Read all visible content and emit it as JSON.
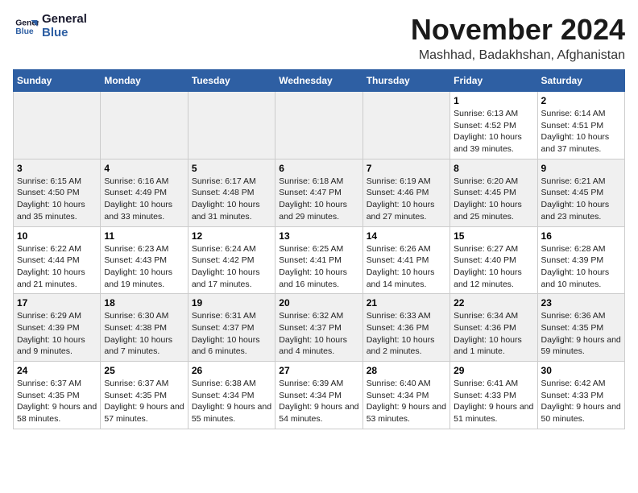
{
  "logo": {
    "line1": "General",
    "line2": "Blue"
  },
  "title": "November 2024",
  "location": "Mashhad, Badakhshan, Afghanistan",
  "weekdays": [
    "Sunday",
    "Monday",
    "Tuesday",
    "Wednesday",
    "Thursday",
    "Friday",
    "Saturday"
  ],
  "weeks": [
    [
      {
        "day": "",
        "info": ""
      },
      {
        "day": "",
        "info": ""
      },
      {
        "day": "",
        "info": ""
      },
      {
        "day": "",
        "info": ""
      },
      {
        "day": "",
        "info": ""
      },
      {
        "day": "1",
        "info": "Sunrise: 6:13 AM\nSunset: 4:52 PM\nDaylight: 10 hours and 39 minutes."
      },
      {
        "day": "2",
        "info": "Sunrise: 6:14 AM\nSunset: 4:51 PM\nDaylight: 10 hours and 37 minutes."
      }
    ],
    [
      {
        "day": "3",
        "info": "Sunrise: 6:15 AM\nSunset: 4:50 PM\nDaylight: 10 hours and 35 minutes."
      },
      {
        "day": "4",
        "info": "Sunrise: 6:16 AM\nSunset: 4:49 PM\nDaylight: 10 hours and 33 minutes."
      },
      {
        "day": "5",
        "info": "Sunrise: 6:17 AM\nSunset: 4:48 PM\nDaylight: 10 hours and 31 minutes."
      },
      {
        "day": "6",
        "info": "Sunrise: 6:18 AM\nSunset: 4:47 PM\nDaylight: 10 hours and 29 minutes."
      },
      {
        "day": "7",
        "info": "Sunrise: 6:19 AM\nSunset: 4:46 PM\nDaylight: 10 hours and 27 minutes."
      },
      {
        "day": "8",
        "info": "Sunrise: 6:20 AM\nSunset: 4:45 PM\nDaylight: 10 hours and 25 minutes."
      },
      {
        "day": "9",
        "info": "Sunrise: 6:21 AM\nSunset: 4:45 PM\nDaylight: 10 hours and 23 minutes."
      }
    ],
    [
      {
        "day": "10",
        "info": "Sunrise: 6:22 AM\nSunset: 4:44 PM\nDaylight: 10 hours and 21 minutes."
      },
      {
        "day": "11",
        "info": "Sunrise: 6:23 AM\nSunset: 4:43 PM\nDaylight: 10 hours and 19 minutes."
      },
      {
        "day": "12",
        "info": "Sunrise: 6:24 AM\nSunset: 4:42 PM\nDaylight: 10 hours and 17 minutes."
      },
      {
        "day": "13",
        "info": "Sunrise: 6:25 AM\nSunset: 4:41 PM\nDaylight: 10 hours and 16 minutes."
      },
      {
        "day": "14",
        "info": "Sunrise: 6:26 AM\nSunset: 4:41 PM\nDaylight: 10 hours and 14 minutes."
      },
      {
        "day": "15",
        "info": "Sunrise: 6:27 AM\nSunset: 4:40 PM\nDaylight: 10 hours and 12 minutes."
      },
      {
        "day": "16",
        "info": "Sunrise: 6:28 AM\nSunset: 4:39 PM\nDaylight: 10 hours and 10 minutes."
      }
    ],
    [
      {
        "day": "17",
        "info": "Sunrise: 6:29 AM\nSunset: 4:39 PM\nDaylight: 10 hours and 9 minutes."
      },
      {
        "day": "18",
        "info": "Sunrise: 6:30 AM\nSunset: 4:38 PM\nDaylight: 10 hours and 7 minutes."
      },
      {
        "day": "19",
        "info": "Sunrise: 6:31 AM\nSunset: 4:37 PM\nDaylight: 10 hours and 6 minutes."
      },
      {
        "day": "20",
        "info": "Sunrise: 6:32 AM\nSunset: 4:37 PM\nDaylight: 10 hours and 4 minutes."
      },
      {
        "day": "21",
        "info": "Sunrise: 6:33 AM\nSunset: 4:36 PM\nDaylight: 10 hours and 2 minutes."
      },
      {
        "day": "22",
        "info": "Sunrise: 6:34 AM\nSunset: 4:36 PM\nDaylight: 10 hours and 1 minute."
      },
      {
        "day": "23",
        "info": "Sunrise: 6:36 AM\nSunset: 4:35 PM\nDaylight: 9 hours and 59 minutes."
      }
    ],
    [
      {
        "day": "24",
        "info": "Sunrise: 6:37 AM\nSunset: 4:35 PM\nDaylight: 9 hours and 58 minutes."
      },
      {
        "day": "25",
        "info": "Sunrise: 6:37 AM\nSunset: 4:35 PM\nDaylight: 9 hours and 57 minutes."
      },
      {
        "day": "26",
        "info": "Sunrise: 6:38 AM\nSunset: 4:34 PM\nDaylight: 9 hours and 55 minutes."
      },
      {
        "day": "27",
        "info": "Sunrise: 6:39 AM\nSunset: 4:34 PM\nDaylight: 9 hours and 54 minutes."
      },
      {
        "day": "28",
        "info": "Sunrise: 6:40 AM\nSunset: 4:34 PM\nDaylight: 9 hours and 53 minutes."
      },
      {
        "day": "29",
        "info": "Sunrise: 6:41 AM\nSunset: 4:33 PM\nDaylight: 9 hours and 51 minutes."
      },
      {
        "day": "30",
        "info": "Sunrise: 6:42 AM\nSunset: 4:33 PM\nDaylight: 9 hours and 50 minutes."
      }
    ]
  ]
}
